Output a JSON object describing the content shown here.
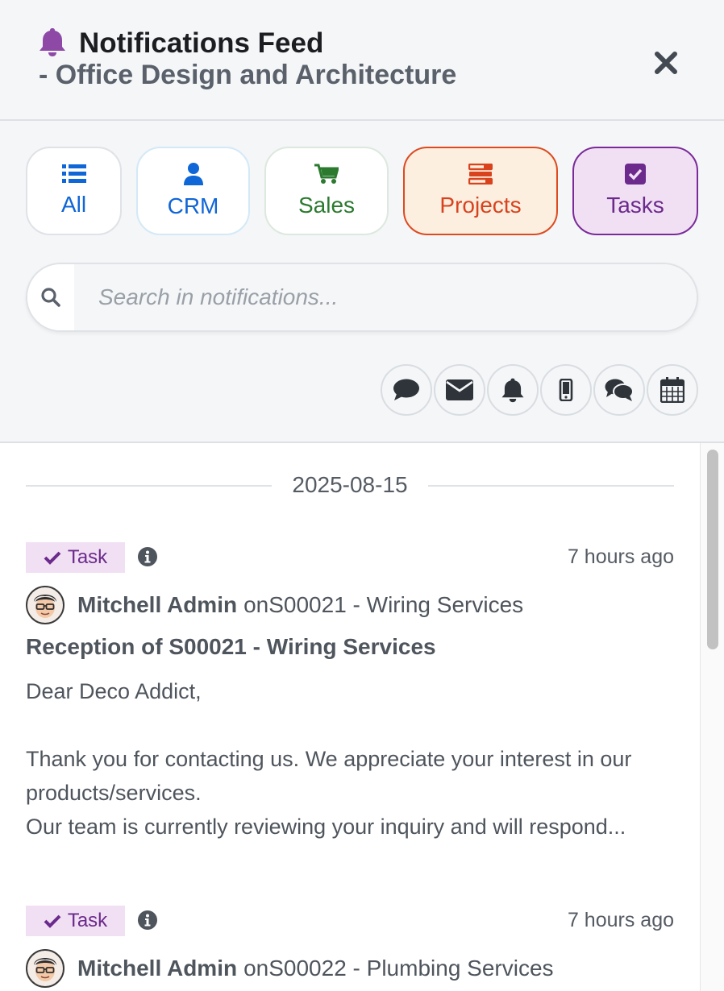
{
  "header": {
    "title": "Notifications Feed",
    "subtitle": "- Office Design and Architecture",
    "bell_icon": "bell-icon",
    "close_icon": "close-icon"
  },
  "filters": {
    "chips": [
      {
        "label": "All",
        "icon": "list-icon",
        "color": "#0f66d6"
      },
      {
        "label": "CRM",
        "icon": "user-icon",
        "color": "#0f66d6"
      },
      {
        "label": "Sales",
        "icon": "cart-icon",
        "color": "#2b7a2f"
      },
      {
        "label": "Projects",
        "icon": "projects-icon",
        "color": "#d8431e"
      },
      {
        "label": "Tasks",
        "icon": "checkbox-icon",
        "color": "#6b2a8c"
      }
    ],
    "selected": [
      "Projects",
      "Tasks"
    ]
  },
  "search": {
    "placeholder": "Search in notifications...",
    "value": ""
  },
  "type_filters": [
    {
      "icon": "comment-icon"
    },
    {
      "icon": "envelope-icon"
    },
    {
      "icon": "bell-icon"
    },
    {
      "icon": "mobile-icon"
    },
    {
      "icon": "comments-icon"
    },
    {
      "icon": "calendar-icon"
    }
  ],
  "feed": {
    "date": "2025-08-15",
    "notifications": [
      {
        "badge": "Task",
        "time": "7 hours ago",
        "author": "Mitchell Admin",
        "on": "on",
        "ref": "S00021 - Wiring Services",
        "subject": "Reception of S00021 - Wiring Services",
        "greeting": "Dear Deco Addict,",
        "body_line1": "Thank you for contacting us. We appreciate your interest in our products/services.",
        "body_line2": "Our team is currently reviewing your inquiry and will respond..."
      },
      {
        "badge": "Task",
        "time": "7 hours ago",
        "author": "Mitchell Admin",
        "on": "on",
        "ref": "S00022 - Plumbing Services"
      }
    ]
  },
  "colors": {
    "task_badge_bg": "#f1e0f3",
    "task_badge_text": "#6b2a8c",
    "header_bg": "#f4f6f8"
  }
}
